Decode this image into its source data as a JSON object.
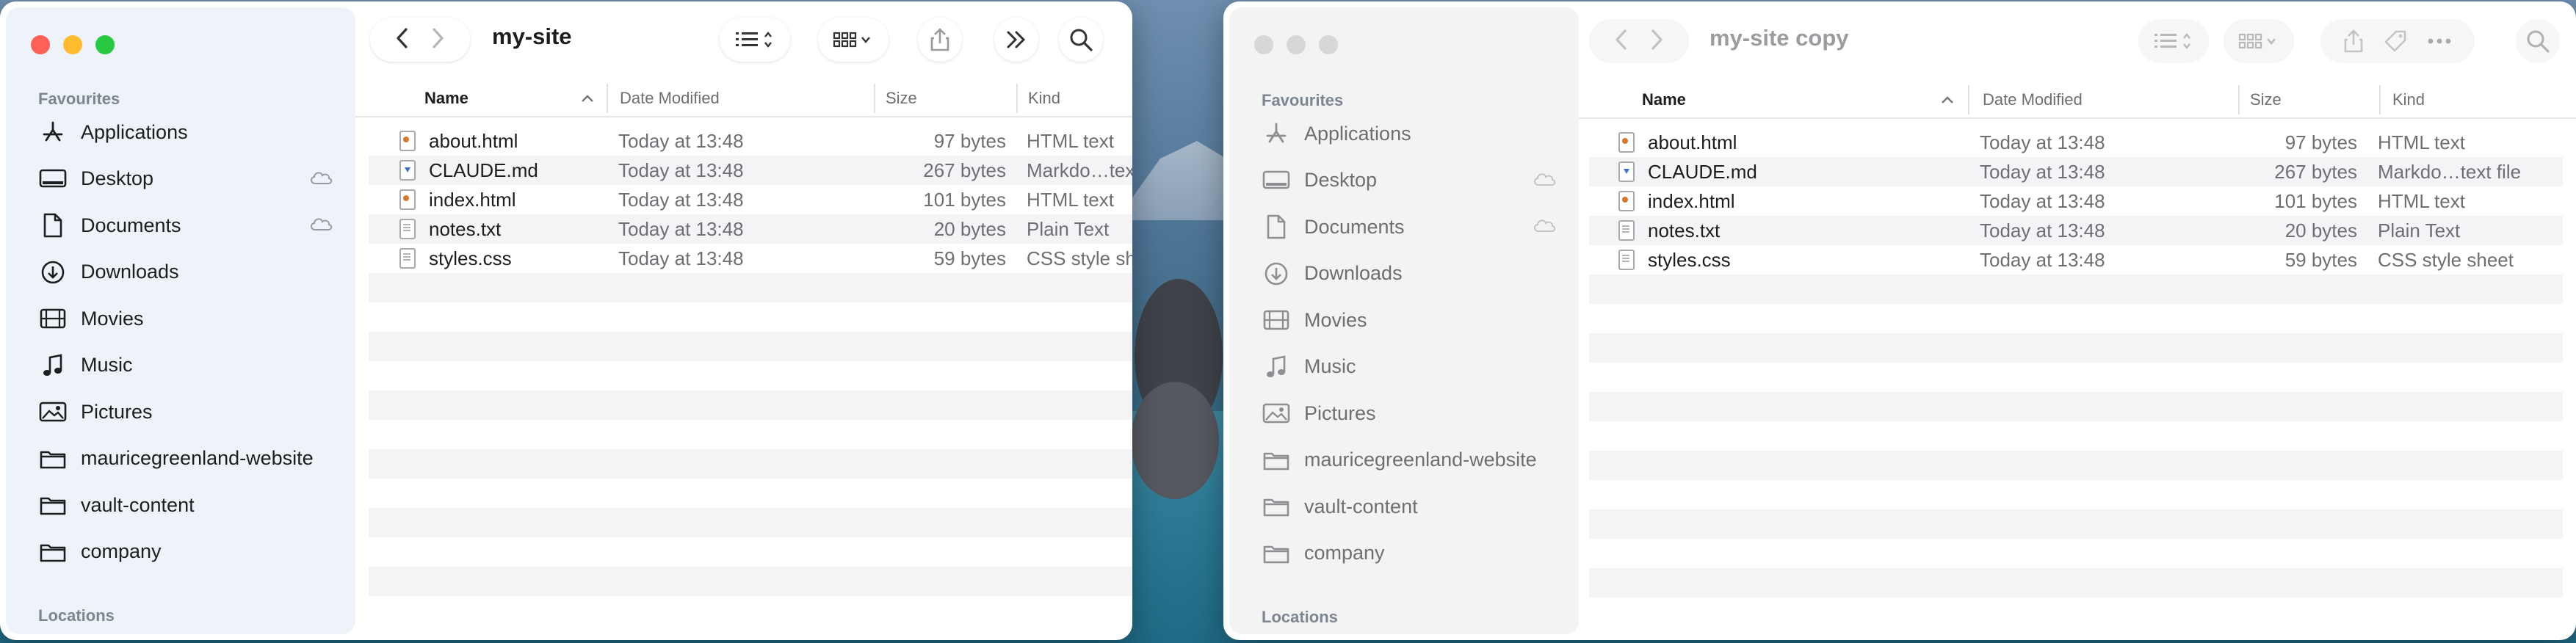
{
  "window1": {
    "title": "my-site",
    "sidebar": {
      "favourites_label": "Favourites",
      "locations_label": "Locations",
      "items": [
        {
          "label": "Applications",
          "icon": "applications-icon"
        },
        {
          "label": "Desktop",
          "icon": "desktop-icon",
          "cloud": true
        },
        {
          "label": "Documents",
          "icon": "documents-icon",
          "cloud": true
        },
        {
          "label": "Downloads",
          "icon": "downloads-icon"
        },
        {
          "label": "Movies",
          "icon": "movies-icon"
        },
        {
          "label": "Music",
          "icon": "music-icon"
        },
        {
          "label": "Pictures",
          "icon": "pictures-icon"
        },
        {
          "label": "mauricegreenland-website",
          "icon": "folder-icon"
        },
        {
          "label": "vault-content",
          "icon": "folder-icon"
        },
        {
          "label": "company",
          "icon": "folder-icon"
        }
      ]
    },
    "columns": {
      "name": "Name",
      "date": "Date Modified",
      "size": "Size",
      "kind": "Kind"
    },
    "files": [
      {
        "name": "about.html",
        "date": "Today at 13:48",
        "size": "97 bytes",
        "kind": "HTML text",
        "type": "html"
      },
      {
        "name": "CLAUDE.md",
        "date": "Today at 13:48",
        "size": "267 bytes",
        "kind": "Markdo…text",
        "type": "md"
      },
      {
        "name": "index.html",
        "date": "Today at 13:48",
        "size": "101 bytes",
        "kind": "HTML text",
        "type": "html"
      },
      {
        "name": "notes.txt",
        "date": "Today at 13:48",
        "size": "20 bytes",
        "kind": "Plain Text",
        "type": "txt"
      },
      {
        "name": "styles.css",
        "date": "Today at 13:48",
        "size": "59 bytes",
        "kind": "CSS style sh",
        "type": "txt"
      }
    ]
  },
  "window2": {
    "title": "my-site copy",
    "sidebar": {
      "favourites_label": "Favourites",
      "locations_label": "Locations",
      "items": [
        {
          "label": "Applications",
          "icon": "applications-icon"
        },
        {
          "label": "Desktop",
          "icon": "desktop-icon",
          "cloud": true
        },
        {
          "label": "Documents",
          "icon": "documents-icon",
          "cloud": true
        },
        {
          "label": "Downloads",
          "icon": "downloads-icon"
        },
        {
          "label": "Movies",
          "icon": "movies-icon"
        },
        {
          "label": "Music",
          "icon": "music-icon"
        },
        {
          "label": "Pictures",
          "icon": "pictures-icon"
        },
        {
          "label": "mauricegreenland-website",
          "icon": "folder-icon"
        },
        {
          "label": "vault-content",
          "icon": "folder-icon"
        },
        {
          "label": "company",
          "icon": "folder-icon"
        }
      ]
    },
    "columns": {
      "name": "Name",
      "date": "Date Modified",
      "size": "Size",
      "kind": "Kind"
    },
    "files": [
      {
        "name": "about.html",
        "date": "Today at 13:48",
        "size": "97 bytes",
        "kind": "HTML text",
        "type": "html"
      },
      {
        "name": "CLAUDE.md",
        "date": "Today at 13:48",
        "size": "267 bytes",
        "kind": "Markdo…text file",
        "type": "md"
      },
      {
        "name": "index.html",
        "date": "Today at 13:48",
        "size": "101 bytes",
        "kind": "HTML text",
        "type": "html"
      },
      {
        "name": "notes.txt",
        "date": "Today at 13:48",
        "size": "20 bytes",
        "kind": "Plain Text",
        "type": "txt"
      },
      {
        "name": "styles.css",
        "date": "Today at 13:48",
        "size": "59 bytes",
        "kind": "CSS style sheet",
        "type": "txt"
      }
    ]
  },
  "colors": {
    "close": "#fe5f57",
    "minimize": "#febc2e",
    "zoom": "#28c840",
    "stripe": "#f4f4f6"
  }
}
